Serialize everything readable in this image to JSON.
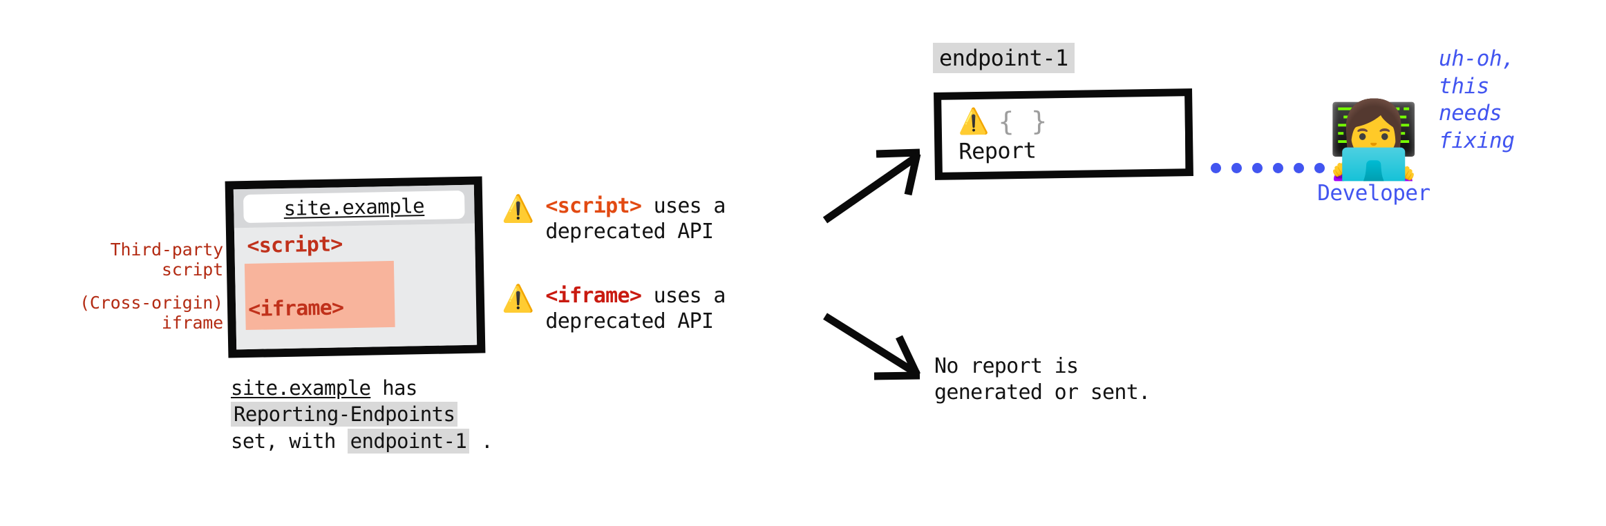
{
  "annotations": {
    "third_party_script": "Third-party\nscript",
    "cross_origin_iframe": "(Cross-origin)\niframe"
  },
  "browser": {
    "url": "site.example",
    "script_tag": "<script>",
    "iframe_tag": "<iframe>",
    "caption": {
      "site": "site.example",
      "has": " has",
      "header_chip": "Reporting-Endpoints",
      "set_with": "set, with ",
      "endpoint_chip": "endpoint-1",
      "period": " ."
    }
  },
  "warnings": [
    {
      "icon": "warning-triangle-icon",
      "icon_glyph": "⚠️",
      "tag": "<script>",
      "message": " uses a\ndeprecated API",
      "tag_color": "#e24a12"
    },
    {
      "icon": "warning-triangle-icon",
      "icon_glyph": "⚠️",
      "tag": "<iframe>",
      "message": " uses a\ndeprecated API",
      "tag_color": "#c91a10"
    }
  ],
  "report": {
    "endpoint_label": "endpoint-1",
    "warn_glyph": "⚠️",
    "braces": "{ }",
    "word": "Report"
  },
  "no_report": "No report is\ngenerated or sent.",
  "developer": {
    "emoji": "👩‍💻",
    "label": "Developer",
    "speech": "uh-oh,\nthis\nneeds\nfixing"
  },
  "colors": {
    "annotation_red": "#b32b13",
    "tag_red": "#c0311b",
    "iframe_highlight": "#f8b49c",
    "chip_gray": "#d9d9d9",
    "blue": "#4255f0",
    "braces_gray": "#9d9d9d",
    "ink": "#0a0a0a"
  },
  "dots": {
    "count": 6,
    "color": "#4255f0"
  }
}
